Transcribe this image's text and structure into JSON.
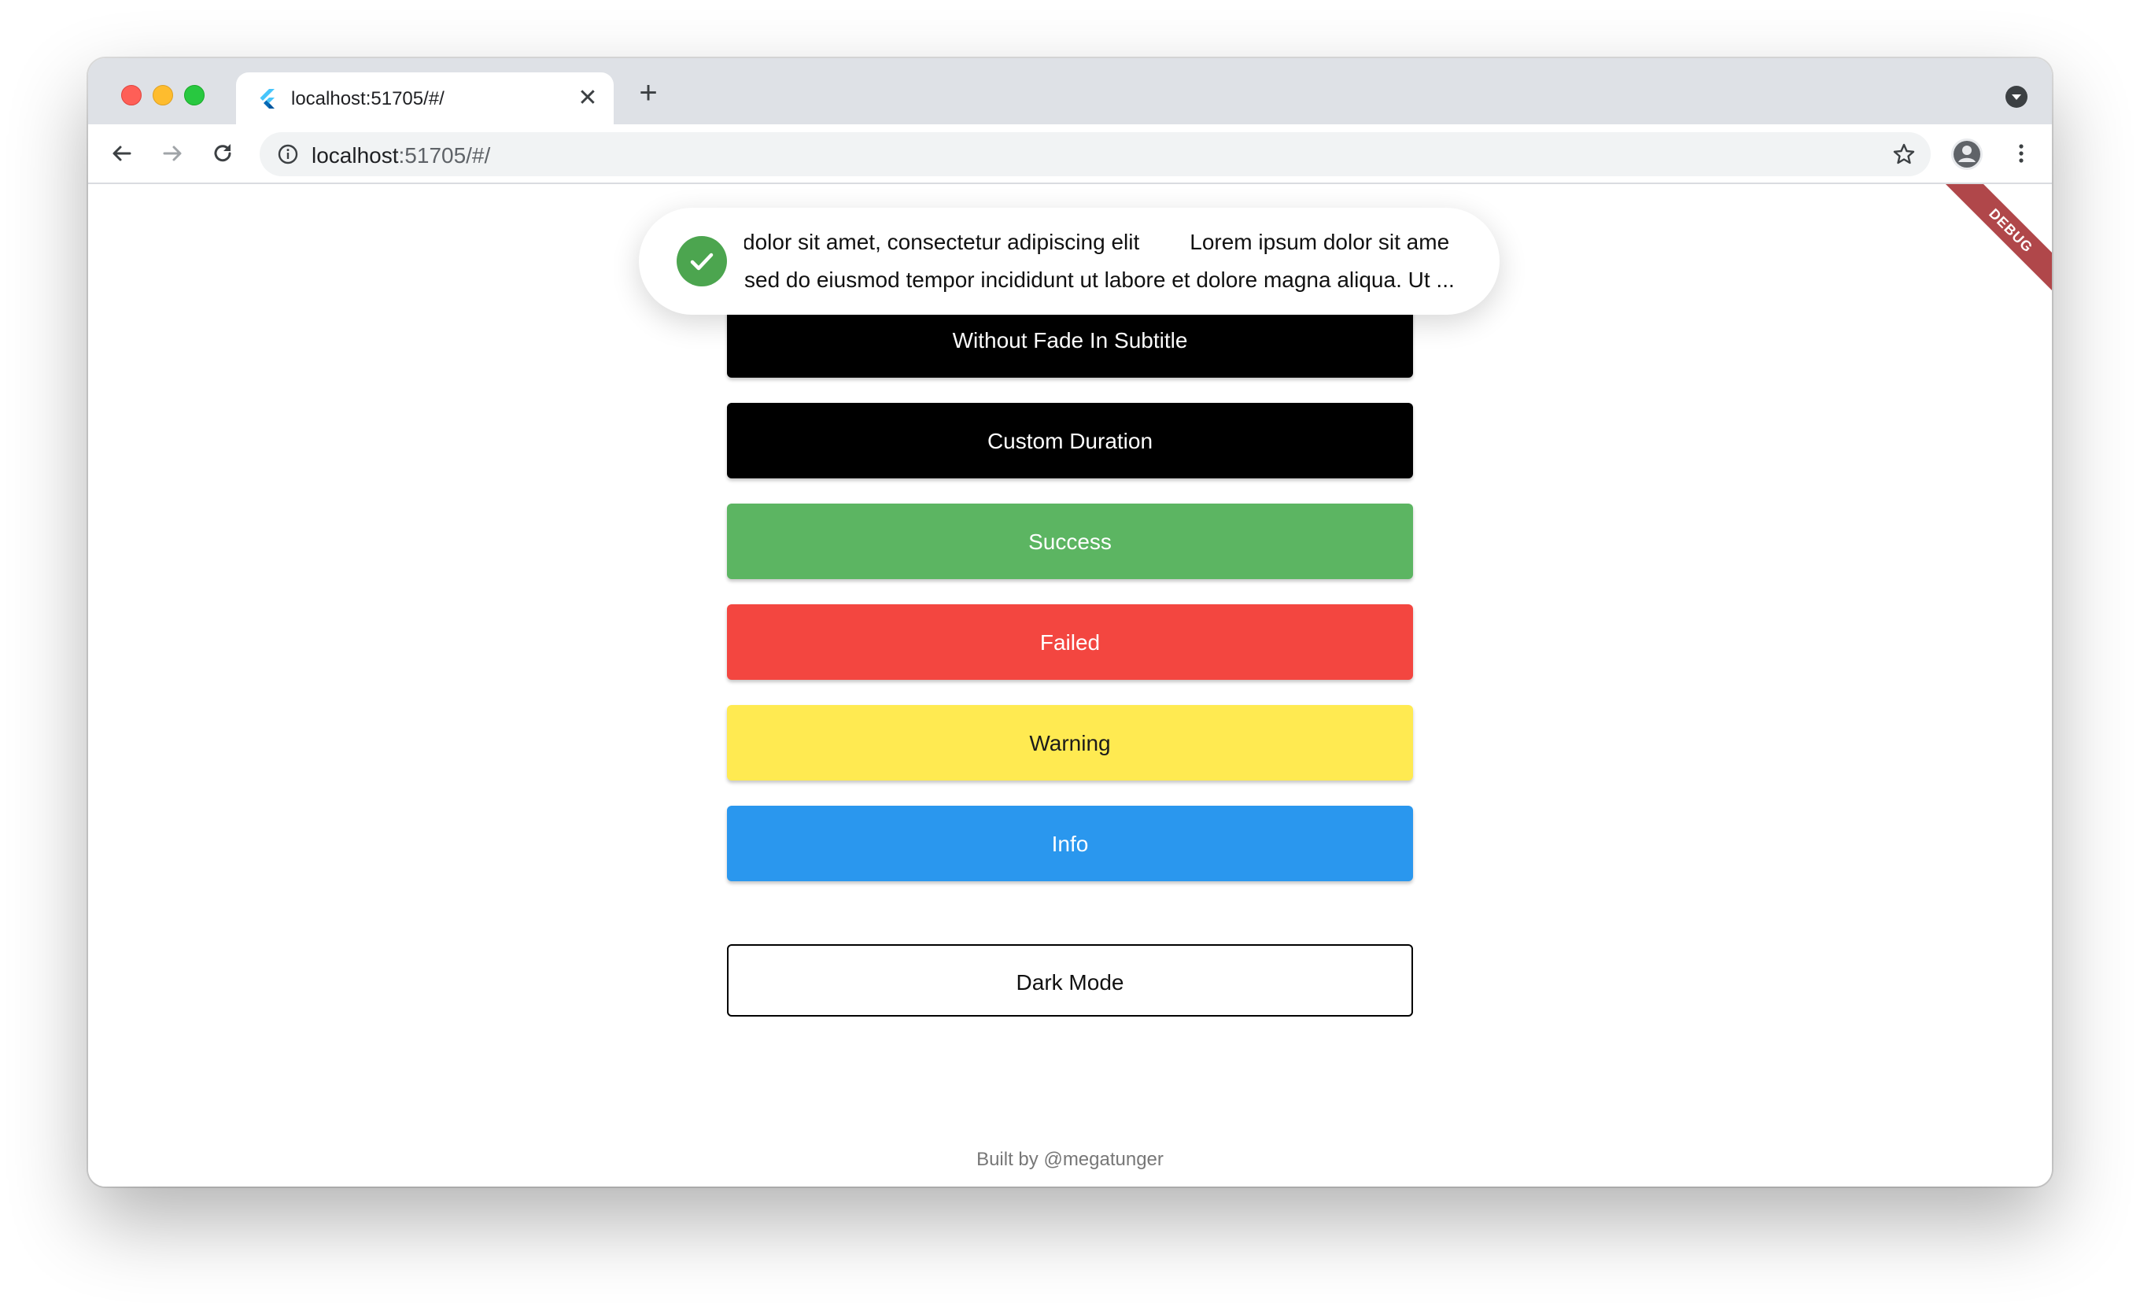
{
  "browser": {
    "tab_title": "localhost:51705/#/",
    "tab_close_glyph": "✕",
    "new_tab_glyph": "+",
    "url_host": "localhost",
    "url_rest": ":51705/#/"
  },
  "icons": {
    "back": "arrow-left-icon",
    "forward": "arrow-right-icon",
    "reload": "reload-icon",
    "site_info": "info-icon",
    "bookmark": "star-icon",
    "profile": "person-icon",
    "menu": "kebab-menu-icon",
    "favicon": "flutter-logo-icon",
    "toast": "check-circle-icon"
  },
  "colors": {
    "success": "#5cb562",
    "failed": "#f34640",
    "warning": "#ffea51",
    "info": "#2a97ee",
    "toast_check": "#4ca54f",
    "debug_ribbon": "#b0474a"
  },
  "toast": {
    "title": "dolor sit amet, consectetur adipiscing elit",
    "title_repeat": "Lorem ipsum dolor sit ame",
    "subtitle": "sed do eiusmod tempor incididunt ut labore et dolore magna aliqua. Ut ..."
  },
  "debug_banner": "DEBUG",
  "buttons": {
    "without_fade": "Without Fade In Subtitle",
    "custom_duration": "Custom Duration",
    "success": "Success",
    "failed": "Failed",
    "warning": "Warning",
    "info": "Info",
    "dark_mode": "Dark Mode"
  },
  "footer": "Built by @megatunger"
}
